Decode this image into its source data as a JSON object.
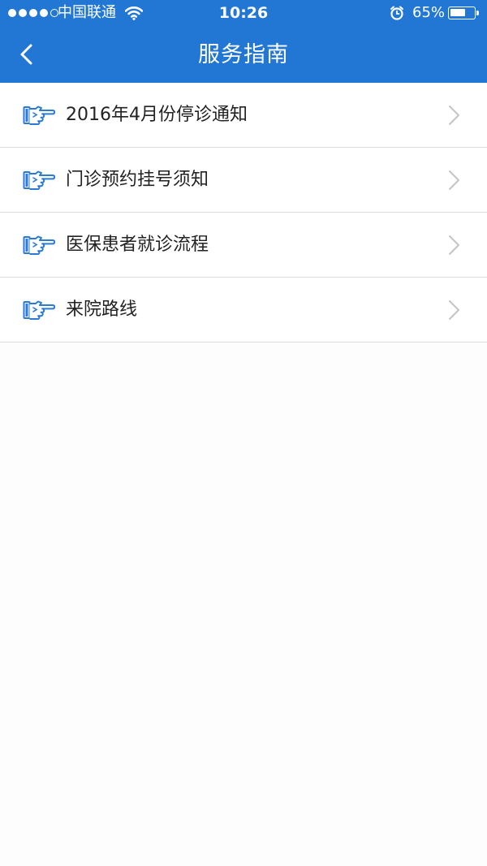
{
  "status_bar": {
    "carrier": "中国联通",
    "time": "10:26",
    "battery_percent": "65%",
    "battery_level": 0.65,
    "signal_bars_filled": 4,
    "signal_bars_total": 5,
    "icons": [
      "wifi-icon",
      "alarm-icon",
      "battery-icon"
    ]
  },
  "nav": {
    "title": "服务指南",
    "back_icon": "chevron-left-icon"
  },
  "list": {
    "item_icon": "pointing-hand-icon",
    "chevron_icon": "chevron-right-icon",
    "items": [
      {
        "label": "2016年4月份停诊通知"
      },
      {
        "label": "门诊预约挂号须知"
      },
      {
        "label": "医保患者就诊流程"
      },
      {
        "label": "来院路线"
      }
    ]
  },
  "colors": {
    "header_bg": "#2177d3",
    "page_bg": "#fdfdfd",
    "list_bg": "#ffffff",
    "divider": "#dcdcdc",
    "icon_accent": "#2b7ad6",
    "chevron": "#c4c4c8",
    "text": "#222222"
  }
}
